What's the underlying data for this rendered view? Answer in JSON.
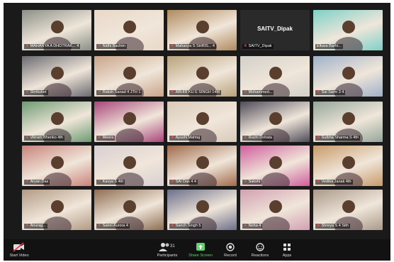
{
  "tiles": [
    {
      "name": "MAHANYA A DHOTRAK... 4",
      "bg": "#8a8f86",
      "muted": true
    },
    {
      "name": "Nidhi Bachim",
      "bg": "#e9d9c8",
      "muted": true
    },
    {
      "name": "Mahanya S SHRIS... 4",
      "bg": "#b08a5e",
      "muted": true
    },
    {
      "name": "SAITV_Dipak",
      "bg": "#2a2a2a",
      "muted": true,
      "dark": true
    },
    {
      "name": "Elkara Barhi...",
      "bg": "#7ed0c7",
      "muted": false
    },
    {
      "name": "Shrikshet",
      "bg": "#6a6a70",
      "muted": true
    },
    {
      "name": "Raksh Sanad 4 JTH 1",
      "bg": "#c9a58b",
      "muted": true
    },
    {
      "name": "ABHIR KU E SINGH 14M",
      "bg": "#b9a27c",
      "muted": true
    },
    {
      "name": "Mohammed...",
      "bg": "#d2d0c8",
      "muted": true
    },
    {
      "name": "Sai Sarm 3 4",
      "bg": "#9fb1c9",
      "muted": true
    },
    {
      "name": "Vikram Bhenko 4th",
      "bg": "#6d9b72",
      "muted": true
    },
    {
      "name": "Meera",
      "bg": "#a8467a",
      "muted": true
    },
    {
      "name": "Ayushi Mahtaj",
      "bg": "#d9cbb9",
      "muted": true
    },
    {
      "name": "Ruchi Dohata",
      "bg": "#4f4c5a",
      "muted": true
    },
    {
      "name": "Sulbha Sharma S 4th",
      "bg": "#94a79a",
      "muted": true
    },
    {
      "name": "Aryan Das",
      "bg": "#c9837a",
      "muted": true
    },
    {
      "name": "Kavya S 4th",
      "bg": "#d8cfd2",
      "muted": true
    },
    {
      "name": "SAI Das 4 4",
      "bg": "#a06a4b",
      "muted": true
    },
    {
      "name": "Sakshi",
      "bg": "#d05d9c",
      "muted": true
    },
    {
      "name": "Vedika Janak 4th",
      "bg": "#c89a6a",
      "muted": true
    },
    {
      "name": "Anurag...",
      "bg": "#b29a84",
      "muted": true
    },
    {
      "name": "Sairel Aurora 4",
      "bg": "#8e6e52",
      "muted": true
    },
    {
      "name": "Sanch Singh 5",
      "bg": "#6c6f8a",
      "muted": true
    },
    {
      "name": "Neha 4",
      "bg": "#d2a0b2",
      "muted": true
    },
    {
      "name": "Shreya S 4 Sith",
      "bg": "#a99a8a",
      "muted": true
    }
  ],
  "toolbar": {
    "start_video": "Start Video",
    "participants": "Participants",
    "participants_count": "31",
    "share_screen": "Share Screen",
    "record": "Record",
    "reactions": "Reactions",
    "apps": "Apps"
  },
  "colors": {
    "share": "#5fd36a",
    "mute": "#ff5050"
  }
}
